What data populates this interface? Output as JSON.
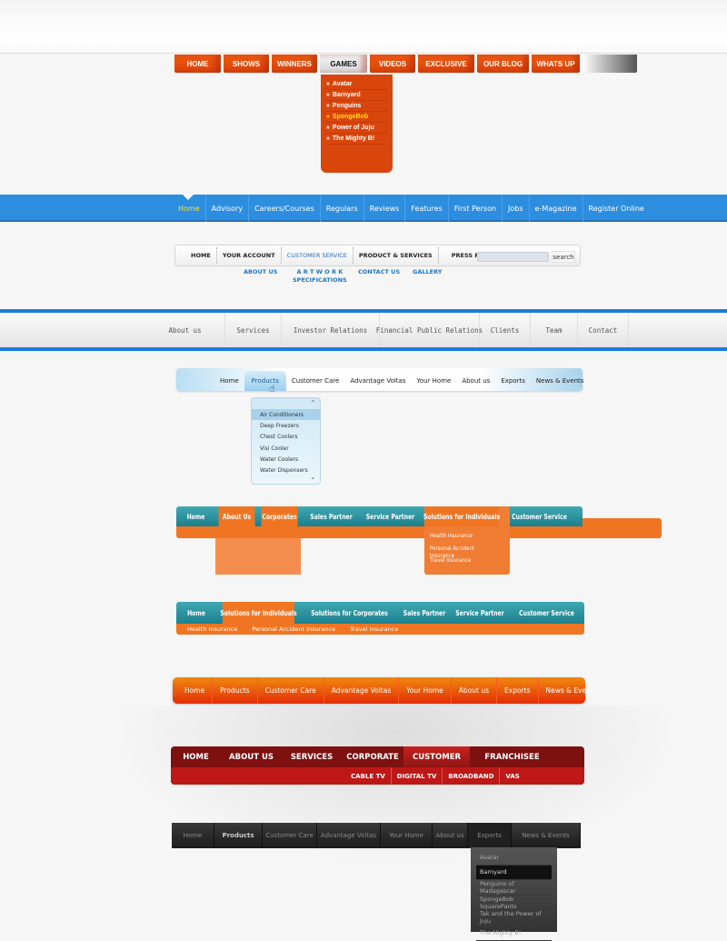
{
  "nav1": {
    "items": [
      "HOME",
      "SHOWS",
      "WINNERS",
      "GAMES",
      "VIDEOS",
      "EXCLUSIVE",
      "OUR BLOG",
      "WHATS UP",
      ""
    ],
    "active": 3,
    "dropdown": [
      "Avatar",
      "Barnyard",
      "Penguins",
      "SpongeBob",
      "Power of Juju",
      "The Mighty B!"
    ],
    "dropdown_highlight": 3,
    "bullet": "»",
    "accent": "#d9460c"
  },
  "nav2": {
    "items": [
      "Home",
      "Advisory",
      "Careers/Courses",
      "Regulars",
      "Reviews",
      "Features",
      "First Person",
      "Jobs",
      "e-Magazine",
      "Register Online"
    ],
    "active": 0,
    "accent": "#2d8ee0"
  },
  "nav3": {
    "items": [
      "HOME",
      "YOUR ACCOUNT",
      "CUSTOMER SERVICE",
      "PRODUCT & SERVICES",
      "PRESS ROOM"
    ],
    "active": 2,
    "search_label": "search",
    "search_value": "",
    "sub": [
      "ABOUT US",
      "A R T W O R K",
      "SPECIFICATIONS",
      "CONTACT US",
      "GALLERY"
    ]
  },
  "nav4": {
    "items": [
      "About us",
      "Services",
      "Investor Relations",
      "Financial Public Relations",
      "Clients",
      "Team",
      "Contact"
    ]
  },
  "nav5": {
    "items": [
      "Home",
      "Products",
      "Customer Care",
      "Advantage Voltas",
      "Your Home",
      "About us",
      "Exports",
      "News & Events"
    ],
    "active": 1,
    "dropdown": [
      "Air Conditioners",
      "Deep Freezers",
      "Chest Coolers",
      "Visi Cooler",
      "Water Coolers",
      "Water Dispensers"
    ],
    "dropdown_highlight": 0
  },
  "nav6": {
    "items": [
      "Home",
      "About Us",
      "Corporates",
      "Sales Partner",
      "Service Partner",
      "Solutions for Individuals",
      "Customer Service"
    ],
    "dropdown": [
      "Health Insurance",
      "Personal Accident Insurance",
      "Travel Insurance"
    ]
  },
  "nav7": {
    "items": [
      "Home",
      "Solutions for Individuals",
      "Solutions for Corporates",
      "Sales Partner",
      "Service Partner",
      "Customer Service"
    ],
    "active": 1,
    "sub": [
      "Health Insurance",
      "Personal Accident Insurance",
      "Travel Insurance"
    ]
  },
  "nav8": {
    "items": [
      "Home",
      "Products",
      "Customer Care",
      "Advantage Voltas",
      "Your Home",
      "About us",
      "Exports",
      "News & Events"
    ]
  },
  "nav9": {
    "items": [
      "HOME",
      "ABOUT US",
      "SERVICES",
      "CORPORATE",
      "CUSTOMER",
      "FRANCHISEE"
    ],
    "active": 4,
    "sub": [
      "CABLE TV",
      "DIGITAL TV",
      "BROADBAND",
      "VAS"
    ]
  },
  "nav10": {
    "items": [
      "Home",
      "Products",
      "Customer Care",
      "Advantage Voltas",
      "Your Home",
      "About us",
      "Exports",
      "News & Events"
    ],
    "active": 6,
    "bold": 1,
    "dropdown": [
      "Avatar",
      "Barnyard",
      "Penguins of Madagascar",
      "SpongeBob SquarePants",
      "Tak and the Power of Juju",
      "The Mighty B!"
    ],
    "dropdown_highlight": 1
  }
}
